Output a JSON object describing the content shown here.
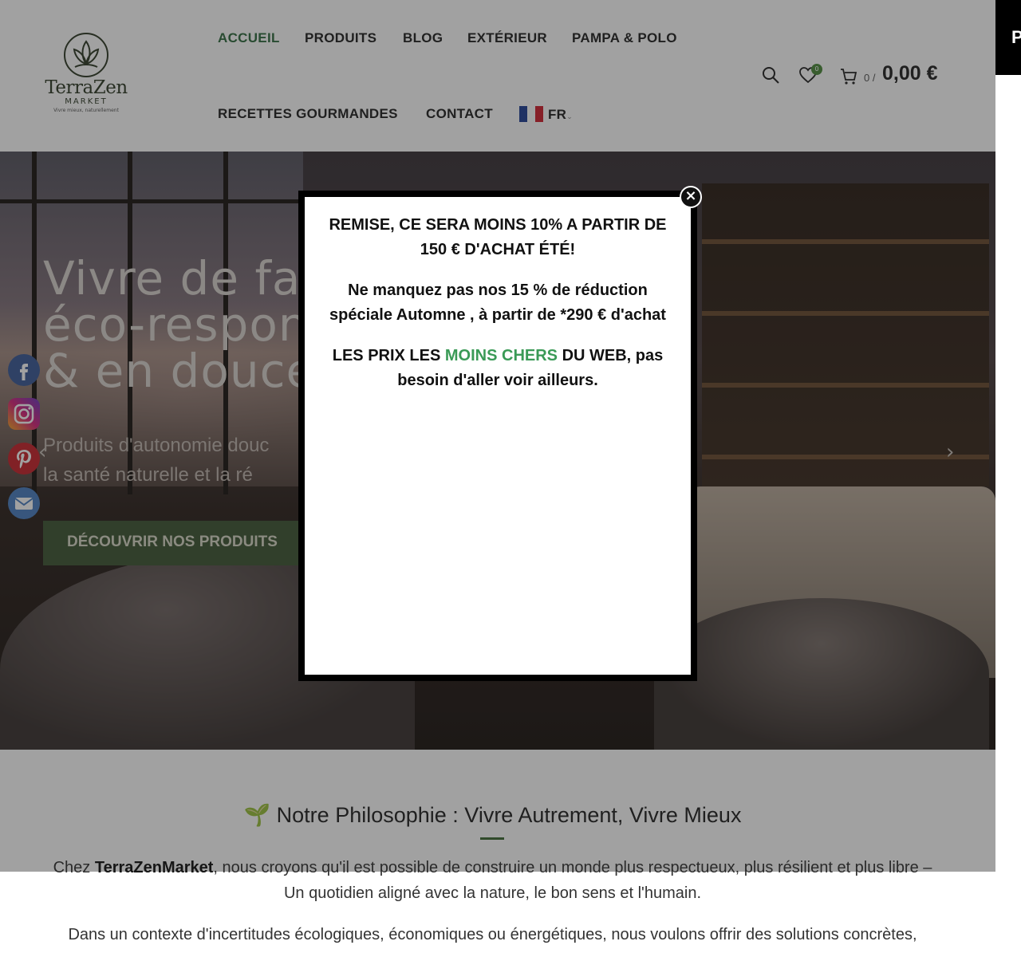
{
  "header": {
    "logo": {
      "name": "TerraZen",
      "market": "MARKET",
      "tagline": "Vivre mieux, naturellement"
    },
    "nav": [
      {
        "label": "ACCUEIL",
        "active": true
      },
      {
        "label": "PRODUITS"
      },
      {
        "label": "BLOG"
      },
      {
        "label": "EXTÉRIEUR"
      },
      {
        "label": "PAMPA & POLO"
      },
      {
        "label": "RECETTES GOURMANDES"
      },
      {
        "label": "CONTACT"
      }
    ],
    "language": "FR",
    "wishlist_count": "0",
    "cart_count": "0 /",
    "cart_total": "0,00 €",
    "icons": {
      "search": "search-icon",
      "wishlist": "heart-icon",
      "cart": "cart-icon"
    },
    "side_tab_letter": "P"
  },
  "hero": {
    "title_lines": [
      "Vivre de fa",
      "éco-respon",
      "& en douce"
    ],
    "subtitle_lines": [
      "Produits d'autonomie douc",
      "la santé naturelle et la ré"
    ],
    "button_label": "DÉCOUVRIR NOS PRODUITS",
    "prev_arrow": "‹",
    "next_arrow": "›"
  },
  "social": [
    "facebook-icon",
    "instagram-icon",
    "pinterest-icon",
    "email-icon"
  ],
  "philosophy": {
    "title": "🌱 Notre Philosophie : Vivre Autrement, Vivre Mieux",
    "p1_pre": "Chez ",
    "p1_brand": "TerraZenMarket",
    "p1_post": ", nous croyons qu'il est possible de construire un monde plus respectueux, plus résilient et plus libre – Un quotidien aligné avec la nature, le bon sens et l'humain.",
    "p2": "Dans un contexte d'incertitudes écologiques, économiques ou énergétiques, nous voulons offrir des solutions concrètes,"
  },
  "modal": {
    "close": "×",
    "line1": "REMISE, CE SERA MOINS 10% A PARTIR DE 150 € D'ACHAT ÉTÉ!",
    "line2": "Ne manquez pas nos 15 % de réduction spéciale Automne , à partir de *290 € d'achat",
    "line3_pre": "LES PRIX LES ",
    "line3_highlight": "MOINS CHERS",
    "line3_post": " DU WEB, pas besoin d'aller voir ailleurs."
  },
  "colors": {
    "accent_green": "#2f6b3e",
    "highlight_green": "#3a9a56",
    "button_green": "#3f5635"
  }
}
